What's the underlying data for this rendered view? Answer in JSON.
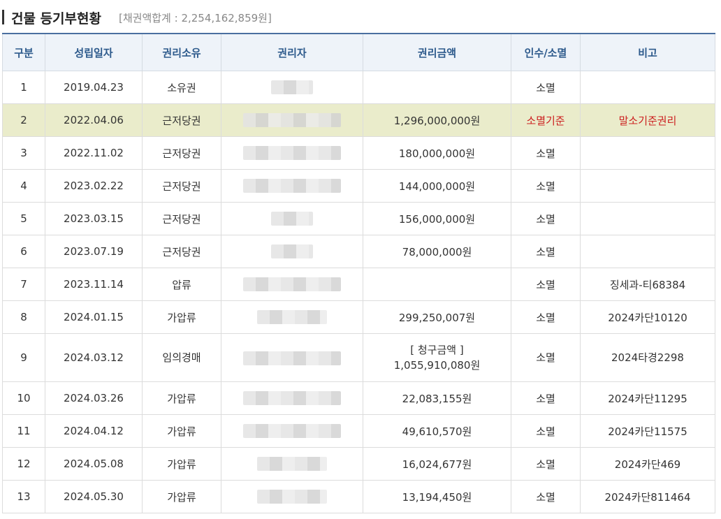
{
  "header": {
    "title": "건물 등기부현황",
    "summary": "[채권액합계 : 2,254,162,859원]"
  },
  "table": {
    "columns": [
      "구분",
      "성립일자",
      "권리소유",
      "권리자",
      "권리금액",
      "인수/소멸",
      "비고"
    ],
    "rows": [
      {
        "no": "1",
        "date": "2019.04.23",
        "type": "소유권",
        "amount": "",
        "status": "소멸",
        "note": ""
      },
      {
        "no": "2",
        "date": "2022.04.06",
        "type": "근저당권",
        "amount": "1,296,000,000원",
        "status": "소멸기준",
        "note": "말소기준권리"
      },
      {
        "no": "3",
        "date": "2022.11.02",
        "type": "근저당권",
        "amount": "180,000,000원",
        "status": "소멸",
        "note": ""
      },
      {
        "no": "4",
        "date": "2023.02.22",
        "type": "근저당권",
        "amount": "144,000,000원",
        "status": "소멸",
        "note": ""
      },
      {
        "no": "5",
        "date": "2023.03.15",
        "type": "근저당권",
        "amount": "156,000,000원",
        "status": "소멸",
        "note": ""
      },
      {
        "no": "6",
        "date": "2023.07.19",
        "type": "근저당권",
        "amount": "78,000,000원",
        "status": "소멸",
        "note": ""
      },
      {
        "no": "7",
        "date": "2023.11.14",
        "type": "압류",
        "amount": "",
        "status": "소멸",
        "note": "징세과-티68384"
      },
      {
        "no": "8",
        "date": "2024.01.15",
        "type": "가압류",
        "amount": "299,250,007원",
        "status": "소멸",
        "note": "2024카단10120"
      },
      {
        "no": "9",
        "date": "2024.03.12",
        "type": "임의경매",
        "amount_label": "[ 청구금액 ]",
        "amount": "1,055,910,080원",
        "status": "소멸",
        "note": "2024타경2298"
      },
      {
        "no": "10",
        "date": "2024.03.26",
        "type": "가압류",
        "amount": "22,083,155원",
        "status": "소멸",
        "note": "2024카단11295"
      },
      {
        "no": "11",
        "date": "2024.04.12",
        "type": "가압류",
        "amount": "49,610,570원",
        "status": "소멸",
        "note": "2024카단11575"
      },
      {
        "no": "12",
        "date": "2024.05.08",
        "type": "가압류",
        "amount": "16,024,677원",
        "status": "소멸",
        "note": "2024카단469"
      },
      {
        "no": "13",
        "date": "2024.05.30",
        "type": "가압류",
        "amount": "13,194,450원",
        "status": "소멸",
        "note": "2024카단811464"
      }
    ]
  }
}
